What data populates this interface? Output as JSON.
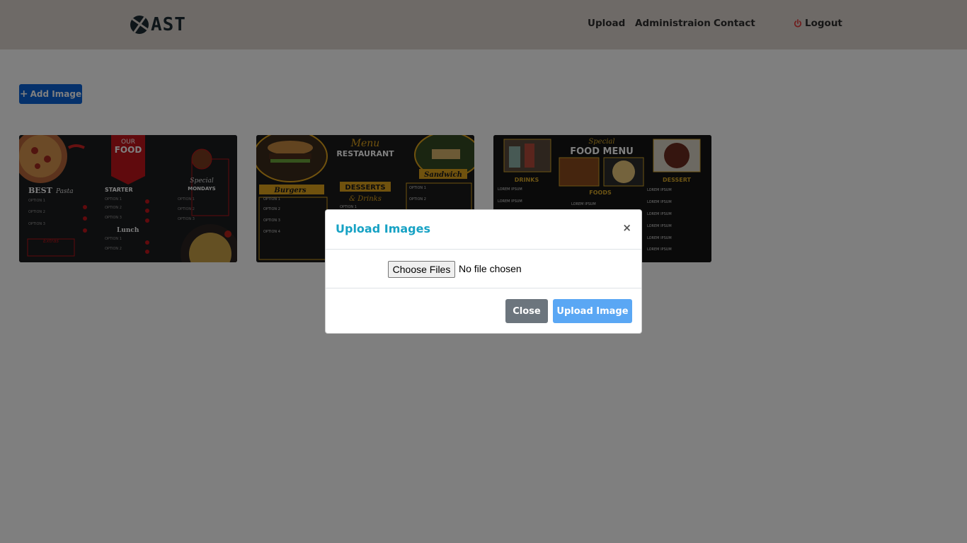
{
  "brand": {
    "logo_text": "AST"
  },
  "nav": {
    "upload": "Upload",
    "administration": "Administraion",
    "contact": "Contact",
    "logout": "Logout"
  },
  "content": {
    "add_image_label": "Add Image",
    "thumbnails": [
      {
        "name": "menu-thumbnail-our-food",
        "texts": [
          "OUR",
          "FOOD",
          "BEST",
          "Pasta",
          "STARTER",
          "Lunch",
          "Special",
          "MONDAYS",
          "Extras",
          "OPTION 1",
          "OPTION 2",
          "OPTION 3"
        ]
      },
      {
        "name": "menu-thumbnail-restaurant",
        "texts": [
          "Menu",
          "RESTAURANT",
          "Burgers",
          "DESSERTS",
          "& Drinks",
          "Sandwich",
          "OPTION 1",
          "OPTION 2",
          "OPTION 3",
          "OPTION 4"
        ]
      },
      {
        "name": "menu-thumbnail-food-menu",
        "texts": [
          "Special",
          "FOOD MENU",
          "DRINKS",
          "FOODS",
          "DESSERT",
          "LOREM IPSUM"
        ]
      }
    ]
  },
  "modal": {
    "title": "Upload Images",
    "close_x": "×",
    "file_button": "Choose Files",
    "file_status": "No file chosen",
    "close_button": "Close",
    "upload_button": "Upload Image"
  },
  "colors": {
    "navbar_bg": "#ddd5cf",
    "primary": "#0a63d6",
    "modal_title": "#17a2c4",
    "close_button": "#6c757d",
    "upload_button": "#5aa7f4",
    "logout_icon": "#e03c3c"
  }
}
